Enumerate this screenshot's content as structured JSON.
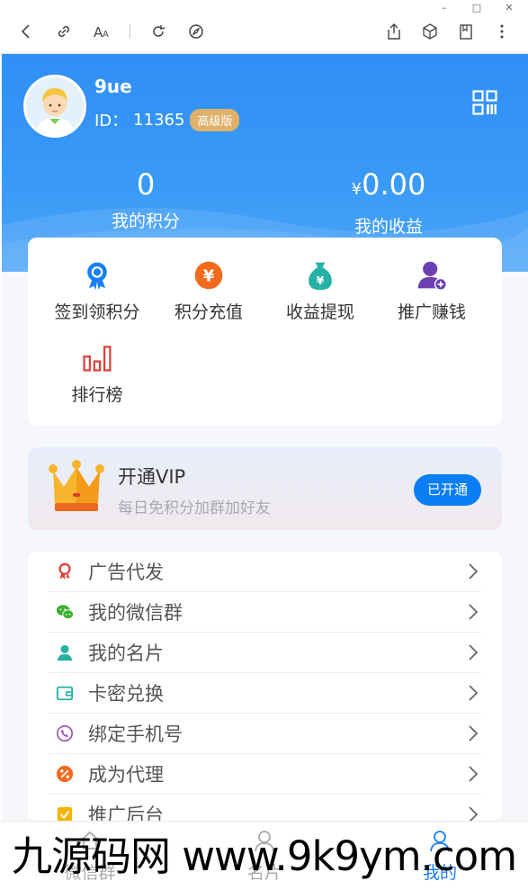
{
  "browser": {
    "window_controls": [
      "–",
      "□",
      "✕"
    ],
    "toolbar_icons_left": [
      "back-icon",
      "link-icon",
      "text-size-icon",
      "refresh-icon",
      "compass-icon"
    ],
    "toolbar_icons_right": [
      "share-icon",
      "cube-icon",
      "collections-icon",
      "more-icon"
    ]
  },
  "user": {
    "name": "9ue",
    "id_label": "ID：",
    "id": "11365",
    "level_badge": "高级版",
    "qr_icon": "qrcode-icon"
  },
  "stats": [
    {
      "value": "0",
      "label": "我的积分"
    },
    {
      "currency": "¥",
      "value": "0.00",
      "label": "我的收益"
    }
  ],
  "grid": [
    {
      "label": "签到领积分",
      "icon": "medal-icon",
      "color": "#1a7ff5"
    },
    {
      "label": "积分充值",
      "icon": "yen-coin-icon",
      "color": "#f26b1d"
    },
    {
      "label": "收益提现",
      "icon": "money-bag-icon",
      "color": "#25b2a5"
    },
    {
      "label": "推广赚钱",
      "icon": "user-add-icon",
      "color": "#6d3fb1"
    },
    {
      "label": "排行榜",
      "icon": "bar-ranking-icon",
      "color": "#e0403a"
    }
  ],
  "vip": {
    "title": "开通VIP",
    "subtitle": "每日免积分加群加好友",
    "button": "已开通"
  },
  "menu": [
    {
      "label": "广告代发",
      "icon": "award-icon",
      "color": "#e0403a"
    },
    {
      "label": "我的微信群",
      "icon": "wechat-icon",
      "color": "#3cb034"
    },
    {
      "label": "我的名片",
      "icon": "person-icon",
      "color": "#25b2a5"
    },
    {
      "label": "卡密兑换",
      "icon": "wallet-icon",
      "color": "#25b2a5"
    },
    {
      "label": "绑定手机号",
      "icon": "phone-icon",
      "color": "#9b4fb5"
    },
    {
      "label": "成为代理",
      "icon": "discount-icon",
      "color": "#f26b1d"
    },
    {
      "label": "推广后台",
      "icon": "check-square-icon",
      "color": "#f5b400"
    }
  ],
  "tabs": [
    {
      "label": "微信群",
      "icon": "home-icon",
      "active": false
    },
    {
      "label": "名片",
      "icon": "user-icon",
      "active": false
    },
    {
      "label": "我的",
      "icon": "user-icon",
      "active": true
    }
  ],
  "watermark": "九源码网 www.9k9ym.com"
}
